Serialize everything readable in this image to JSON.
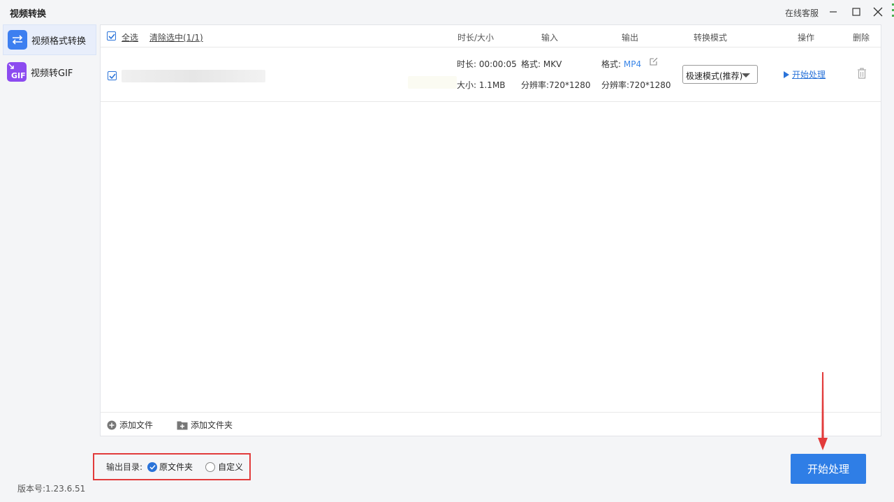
{
  "app": {
    "title": "视频转换",
    "online_service": "在线客服"
  },
  "sidebar": {
    "items": [
      {
        "label": "视频格式转换",
        "icon": "swap-arrows-icon",
        "active": true
      },
      {
        "label": "视频转GIF",
        "icon": "gif-icon",
        "active": false
      }
    ],
    "gif_icon_text": "GIF"
  },
  "table": {
    "select_all": "全选",
    "clear_selected": "清除选中(1/1)",
    "columns": {
      "duration_size": "时长/大小",
      "input": "输入",
      "output": "输出",
      "mode": "转换模式",
      "action": "操作",
      "delete": "删除"
    },
    "rows": [
      {
        "checked": true,
        "duration": "时长: 00:00:05",
        "size": "大小: 1.1MB",
        "input_format_label": "格式: ",
        "input_format": "MKV",
        "input_resolution": "分辨率:720*1280",
        "output_format_label": "格式: ",
        "output_format": "MP4",
        "output_resolution": "分辨率:720*1280",
        "mode": "极速模式(推荐)",
        "action": "开始处理"
      }
    ]
  },
  "footer": {
    "add_file": "添加文件",
    "add_folder": "添加文件夹"
  },
  "output_dir": {
    "label": "输出目录:",
    "options": [
      {
        "label": "原文件夹",
        "checked": true
      },
      {
        "label": "自定义",
        "checked": false
      }
    ]
  },
  "start_button": "开始处理",
  "version": "版本号:1.23.6.51",
  "colors": {
    "accent": "#2f7ee6",
    "highlight_box": "#e23b3b",
    "annotation_arrow": "#e23b3b"
  }
}
